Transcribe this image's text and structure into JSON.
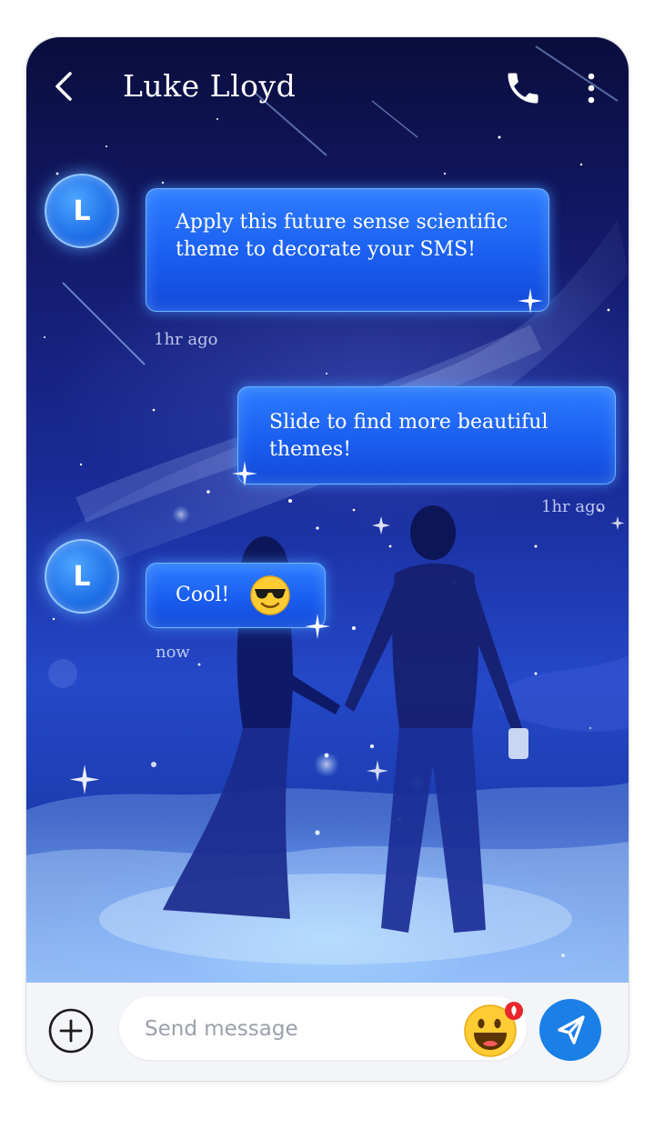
{
  "header": {
    "title": "Luke Lloyd",
    "back_icon": "chevron-left-icon",
    "call_icon": "phone-icon",
    "more_icon": "more-vertical-icon"
  },
  "messages": [
    {
      "avatar": "L",
      "text": "Apply this future sense scientific theme to decorate your SMS!",
      "time": "1hr ago",
      "direction": "incoming"
    },
    {
      "avatar": "",
      "text": "Slide to find more beautiful themes!",
      "time": "1hr ago",
      "direction": "outgoing"
    },
    {
      "avatar": "L",
      "text": "Cool!",
      "emoji": "sunglasses-face",
      "time": "now",
      "direction": "incoming"
    }
  ],
  "composer": {
    "placeholder": "Send message",
    "add_icon": "plus-circle-icon",
    "emoji_icon": "grinning-face-icon",
    "send_icon": "send-icon"
  },
  "colors": {
    "bubble": "#1a5ef0",
    "send_button": "#1a7fe6",
    "bottom_bar": "#f3f5f9"
  }
}
